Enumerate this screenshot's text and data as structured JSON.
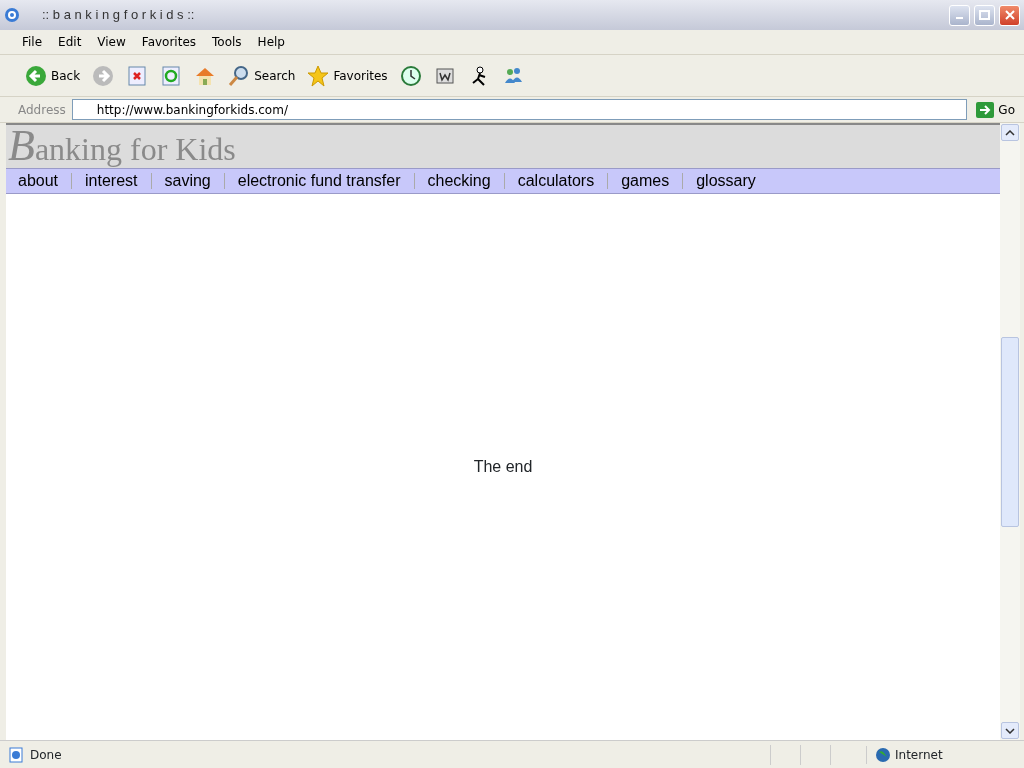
{
  "window": {
    "title": ":: b a n k i n g f o r k i d s ::"
  },
  "menu": [
    "File",
    "Edit",
    "View",
    "Favorites",
    "Tools",
    "Help"
  ],
  "toolbar": [
    {
      "kind": "back",
      "label": "Back"
    },
    {
      "kind": "forward"
    },
    {
      "kind": "stop"
    },
    {
      "kind": "refresh"
    },
    {
      "kind": "home"
    },
    {
      "kind": "search",
      "label": "Search"
    },
    {
      "kind": "favorites",
      "label": "Favorites"
    },
    {
      "kind": "history"
    },
    {
      "kind": "word"
    },
    {
      "kind": "runner"
    },
    {
      "kind": "messenger"
    }
  ],
  "address": {
    "label": "Address",
    "value": "http://www.bankingforkids.com/",
    "go": "Go"
  },
  "page": {
    "logo": "Banking for Kids",
    "nav": [
      "about",
      "interest",
      "saving",
      "electronic fund transfer",
      "checking",
      "calculators",
      "games",
      "glossary"
    ],
    "body_text": "The end"
  },
  "status_bar": {
    "text": "Done",
    "zone": "Internet"
  }
}
